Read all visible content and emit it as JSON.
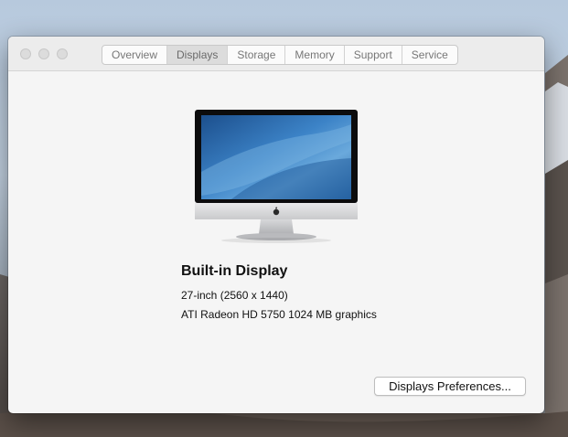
{
  "tabs": [
    {
      "label": "Overview"
    },
    {
      "label": "Displays"
    },
    {
      "label": "Storage"
    },
    {
      "label": "Memory"
    },
    {
      "label": "Support"
    },
    {
      "label": "Service"
    }
  ],
  "active_tab": "Displays",
  "display": {
    "name": "Built-in Display",
    "size_resolution": "27-inch (2560 x 1440)",
    "graphics": "ATI Radeon HD 5750 1024 MB graphics"
  },
  "buttons": {
    "display_preferences": "Displays Preferences..."
  },
  "icons": {
    "computer": "imac-icon",
    "apple_logo": "apple-logo-icon"
  },
  "colors": {
    "window_bg": "#f5f5f5",
    "active_tab_bg": "#dcdcdc",
    "screen_blue": "#2f6fb3"
  }
}
